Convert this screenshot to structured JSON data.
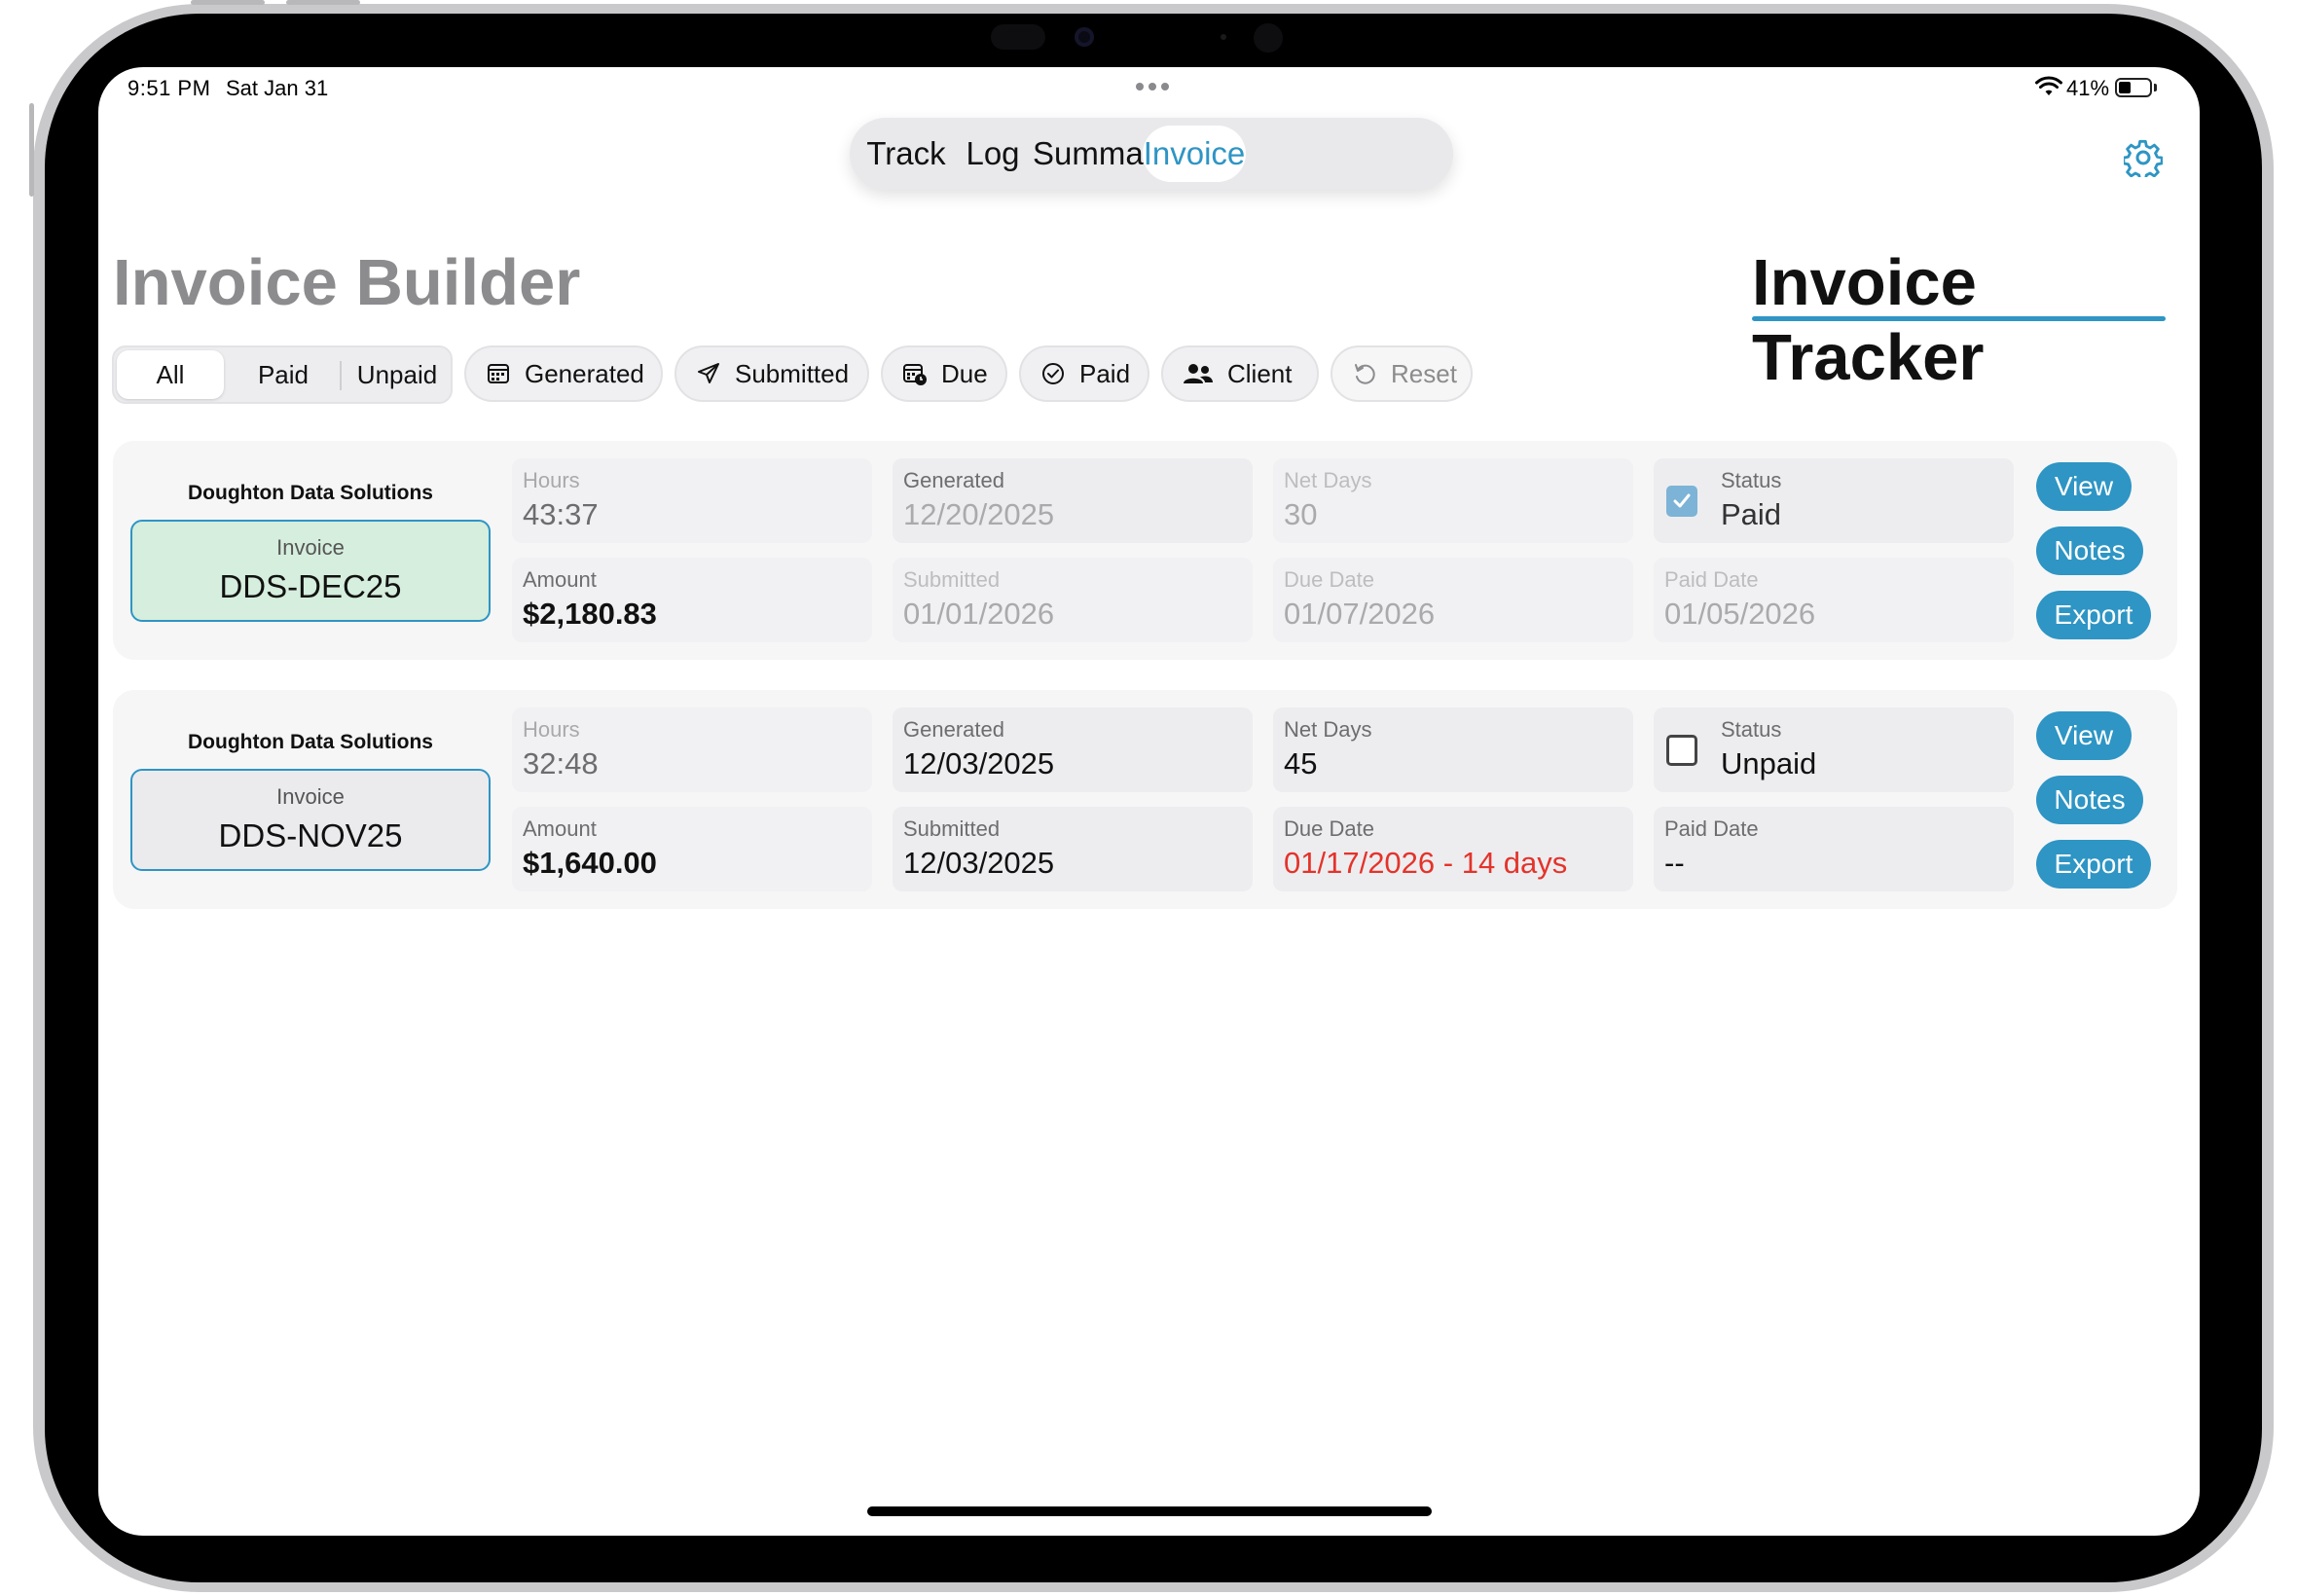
{
  "status_bar": {
    "time": "9:51 PM",
    "date": "Sat Jan 31",
    "battery_percent": "41%",
    "battery_level": 0.41,
    "icons": [
      "wifi-icon",
      "battery-icon",
      "multitasking-dots-icon"
    ]
  },
  "nav": {
    "tabs": [
      {
        "label": "Track",
        "active": false
      },
      {
        "label": "Log",
        "active": false
      },
      {
        "label": "Summary",
        "active": false
      },
      {
        "label": "Invoice",
        "active": true
      }
    ],
    "settings_icon": "gear-icon"
  },
  "headings": {
    "builder": "Invoice Builder",
    "tracker": "Invoice Tracker"
  },
  "filters": {
    "segments": [
      "All",
      "Paid",
      "Unpaid"
    ],
    "selected_segment": "All",
    "chips": [
      {
        "label": "Generated",
        "icon": "calendar-icon"
      },
      {
        "label": "Submitted",
        "icon": "paper-plane-icon"
      },
      {
        "label": "Due",
        "icon": "calendar-clock-icon"
      },
      {
        "label": "Paid",
        "icon": "checkmark-circle-icon"
      },
      {
        "label": "Client",
        "icon": "people-icon"
      },
      {
        "label": "Reset",
        "icon": "reset-arrow-icon"
      }
    ]
  },
  "invoices": [
    {
      "client": "Doughton Data Solutions",
      "invoice_label": "Invoice",
      "invoice_number": "DDS-DEC25",
      "hours_label": "Hours",
      "hours": "43:37",
      "amount_label": "Amount",
      "amount": "$2,180.83",
      "generated_label": "Generated",
      "generated": "12/20/2025",
      "submitted_label": "Submitted",
      "submitted": "01/01/2026",
      "net_days_label": "Net Days",
      "net_days": "30",
      "due_date_label": "Due Date",
      "due_date": "01/07/2026",
      "status_label": "Status",
      "status": "Paid",
      "status_checked": true,
      "paid_date_label": "Paid Date",
      "paid_date": "01/05/2026",
      "buttons": {
        "view": "View",
        "notes": "Notes",
        "export": "Export"
      }
    },
    {
      "client": "Doughton Data Solutions",
      "invoice_label": "Invoice",
      "invoice_number": "DDS-NOV25",
      "hours_label": "Hours",
      "hours": "32:48",
      "amount_label": "Amount",
      "amount": "$1,640.00",
      "generated_label": "Generated",
      "generated": "12/03/2025",
      "submitted_label": "Submitted",
      "submitted": "12/03/2025",
      "net_days_label": "Net Days",
      "net_days": "45",
      "due_date_label": "Due Date",
      "due_date": "01/17/2026 - 14 days",
      "status_label": "Status",
      "status": "Unpaid",
      "status_checked": false,
      "paid_date_label": "Paid Date",
      "paid_date": "--",
      "buttons": {
        "view": "View",
        "notes": "Notes",
        "export": "Export"
      }
    }
  ],
  "colors": {
    "accent": "#2e95c4",
    "paid_invoice_bg": "#d6eedd",
    "overdue_red": "#e4332a",
    "card_bg": "#f6f6f7"
  }
}
